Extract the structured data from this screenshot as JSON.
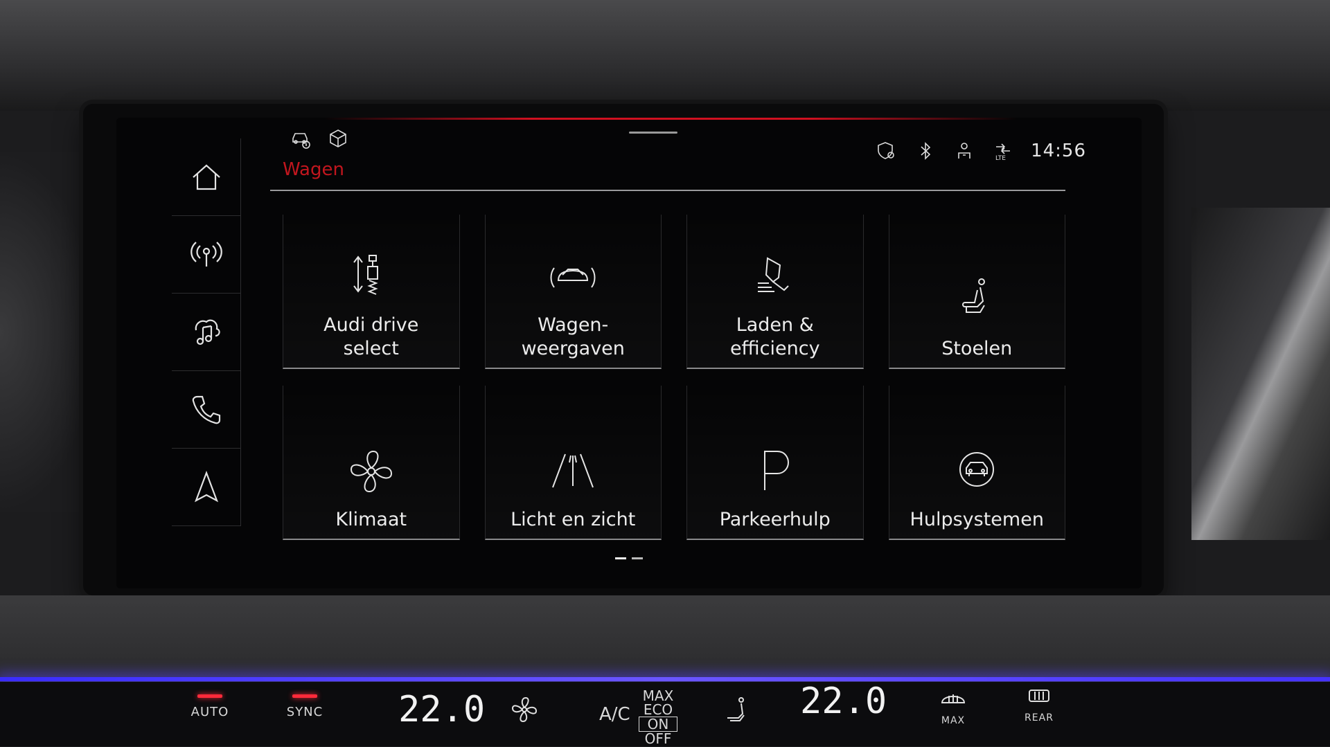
{
  "status_bar": {
    "time": "14:56",
    "left_icons": [
      "car-info-icon",
      "cube-icon"
    ],
    "right_icons": [
      "location-shield-icon",
      "bluetooth-icon",
      "user-help-icon",
      "lte-signal-icon"
    ],
    "lte_label": "LTE"
  },
  "sidebar": {
    "items": [
      {
        "name": "home",
        "icon": "home-icon"
      },
      {
        "name": "radio",
        "icon": "radio-icon"
      },
      {
        "name": "media",
        "icon": "music-icon"
      },
      {
        "name": "phone",
        "icon": "phone-icon"
      },
      {
        "name": "navigation",
        "icon": "navigation-icon"
      }
    ]
  },
  "page": {
    "title": "Wagen",
    "accent_color": "#c2161e"
  },
  "tiles": [
    {
      "label": "Audi drive\nselect",
      "icon": "suspension-icon"
    },
    {
      "label": "Wagen-\nweergaven",
      "icon": "car-view-icon"
    },
    {
      "label": "Laden &\nefficiency",
      "icon": "charging-efficiency-icon"
    },
    {
      "label": "Stoelen",
      "icon": "seat-icon"
    },
    {
      "label": "Klimaat",
      "icon": "fan-icon"
    },
    {
      "label": "Licht en zicht",
      "icon": "road-lights-icon"
    },
    {
      "label": "Parkeerhulp",
      "icon": "parking-icon"
    },
    {
      "label": "Hulpsystemen",
      "icon": "assist-systems-icon"
    }
  ],
  "pager": {
    "pages": 2,
    "current": 1
  },
  "climate": {
    "auto_label": "AUTO",
    "sync_label": "SYNC",
    "left_temp": "22.0",
    "right_temp": "22.0",
    "ac_label": "A/C",
    "max_label": "MAX",
    "eco_label": "ECO",
    "on_label": "ON",
    "off_label": "OFF",
    "max_defrost_label": "MAX",
    "rear_label": "REAR"
  }
}
